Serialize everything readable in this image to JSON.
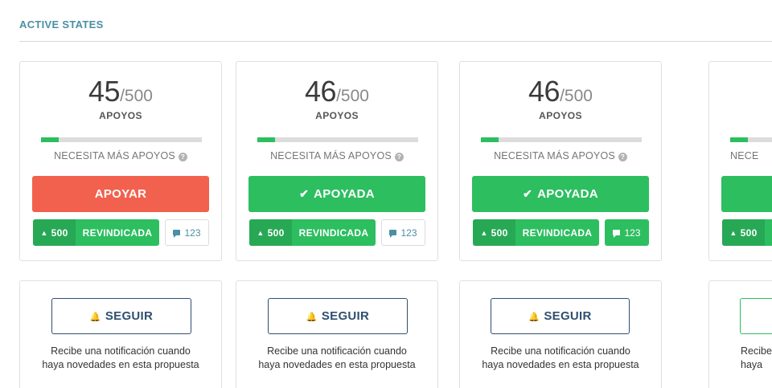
{
  "section": {
    "title": "ACTIVE STATES"
  },
  "cards": [
    {
      "count": "45",
      "total": "/500",
      "label": "APOYOS",
      "progress_fraction": 0.11,
      "needs": "NECESITA MÁS APOYOS",
      "button": "APOYAR",
      "button_style": "red",
      "button_checked": false,
      "claim_count": "500",
      "claim_label": "REVINDICADA",
      "comments": "123",
      "comments_style": "outline"
    },
    {
      "count": "46",
      "total": "/500",
      "label": "APOYOS",
      "progress_fraction": 0.11,
      "needs": "NECESITA MÁS APOYOS",
      "button": "APOYADA",
      "button_style": "green",
      "button_checked": true,
      "claim_count": "500",
      "claim_label": "REVINDICADA",
      "comments": "123",
      "comments_style": "outline"
    },
    {
      "count": "46",
      "total": "/500",
      "label": "APOYOS",
      "progress_fraction": 0.11,
      "needs": "NECESITA MÁS APOYOS",
      "button": "APOYADA",
      "button_style": "green",
      "button_checked": true,
      "claim_count": "500",
      "claim_label": "REVINDICADA",
      "comments": "123",
      "comments_style": "solid"
    },
    {
      "count": "",
      "total": "",
      "label": "",
      "progress_fraction": 0.11,
      "needs": "NECE",
      "button": "",
      "button_style": "green",
      "button_checked": false,
      "claim_count": "500",
      "claim_label": "",
      "comments": "",
      "comments_style": "none"
    }
  ],
  "follow_cards": [
    {
      "button": "SEGUIR",
      "description_line1": "Recibe una notificación cuando",
      "description_line2": "haya novedades en esta propuesta"
    },
    {
      "button": "SEGUIR",
      "description_line1": "Recibe una notificación cuando",
      "description_line2": "haya novedades en esta propuesta"
    },
    {
      "button": "SEGUIR",
      "description_line1": "Recibe una notificación cuando",
      "description_line2": "haya novedades en esta propuesta"
    },
    {
      "button": "",
      "description_line1": "Recibe",
      "description_line2": "haya"
    }
  ],
  "colors": {
    "accent_teal": "#4a8fa3",
    "support_red": "#f2614e",
    "supported_green": "#2dbe60",
    "dark_green": "#27a855",
    "follow_navy": "#2f4f6f"
  },
  "icons": {
    "info": "info-icon",
    "check": "check-icon",
    "megaphone": "megaphone-icon",
    "comment": "comment-icon",
    "bell": "bell-icon"
  }
}
